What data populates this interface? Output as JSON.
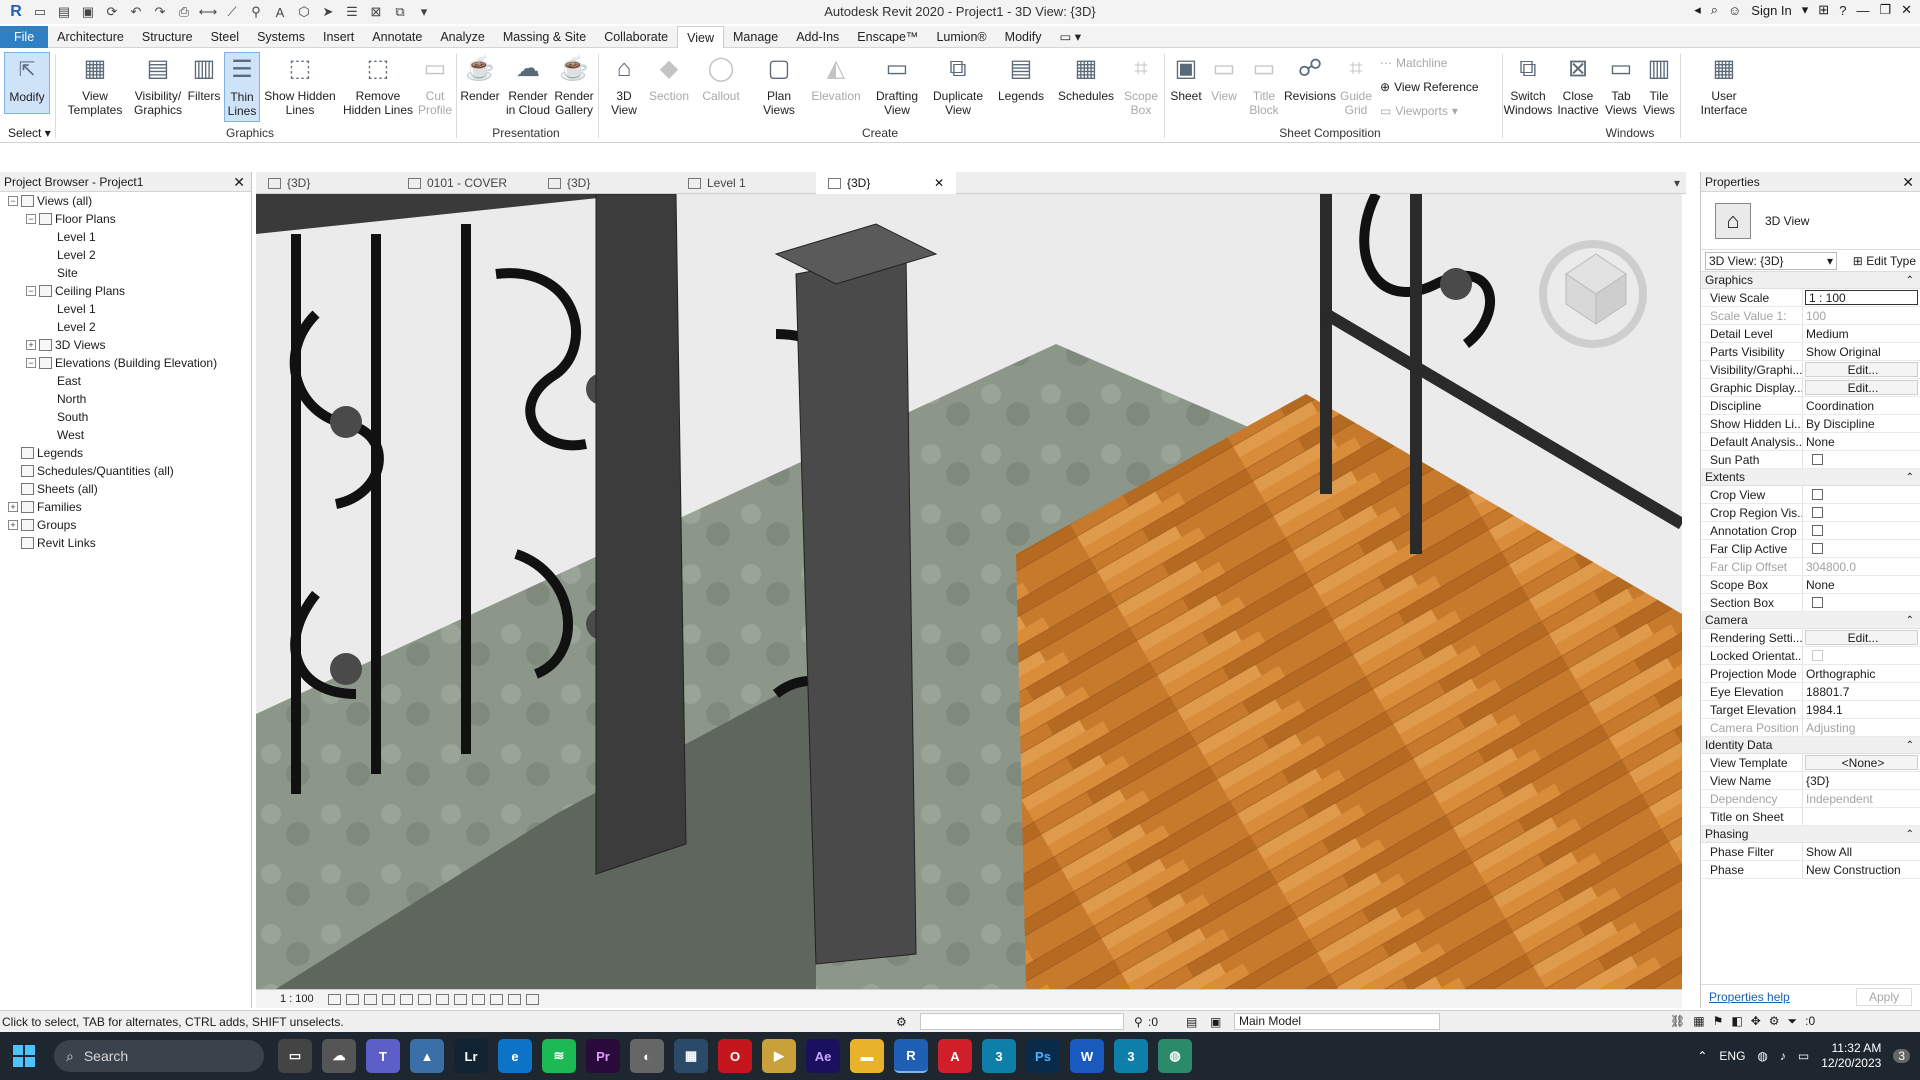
{
  "title": "Autodesk Revit 2020 - Project1 - 3D View: {3D}",
  "signin": "Sign In",
  "tabs": [
    "File",
    "Architecture",
    "Structure",
    "Steel",
    "Systems",
    "Insert",
    "Annotate",
    "Analyze",
    "Massing & Site",
    "Collaborate",
    "View",
    "Manage",
    "Add-Ins",
    "Enscape™",
    "Lumion®",
    "Modify"
  ],
  "active_tab": "View",
  "ribbon": {
    "select_label": "Select",
    "graphics_panel": "Graphics",
    "presentation_panel": "Presentation",
    "create_panel": "Create",
    "sheet_panel": "Sheet Composition",
    "windows_panel": "Windows",
    "modify": "Modify",
    "view_templates": "View Templates",
    "visibility": "Visibility/ Graphics",
    "filters": "Filters",
    "thin_lines": "Thin Lines",
    "show_hidden": "Show Hidden Lines",
    "remove_hidden": "Remove Hidden Lines",
    "cut_profile": "Cut Profile",
    "render": "Render",
    "render_cloud": "Render in Cloud",
    "render_gallery": "Render Gallery",
    "view3d": "3D View",
    "section": "Section",
    "callout": "Callout",
    "plan_views": "Plan Views",
    "elevation": "Elevation",
    "drafting": "Drafting View",
    "duplicate": "Duplicate View",
    "legends": "Legends",
    "schedules": "Schedules",
    "scope_box": "Scope Box",
    "sheet": "Sheet",
    "view": "View",
    "title_block": "Title Block",
    "revisions": "Revisions",
    "guide_grid": "Guide Grid",
    "matchline": "Matchline",
    "view_reference": "View Reference",
    "viewports": "Viewports",
    "switch_windows": "Switch Windows",
    "close_inactive": "Close Inactive",
    "tab_views": "Tab Views",
    "tile_views": "Tile Views",
    "user_interface": "User Interface"
  },
  "browser": {
    "title": "Project Browser - Project1",
    "nodes": [
      {
        "label": "Views (all)",
        "level": 0,
        "toggle": "−"
      },
      {
        "label": "Floor Plans",
        "level": 1,
        "toggle": "−"
      },
      {
        "label": "Level 1",
        "level": 2,
        "toggle": ""
      },
      {
        "label": "Level 2",
        "level": 2,
        "toggle": ""
      },
      {
        "label": "Site",
        "level": 2,
        "toggle": ""
      },
      {
        "label": "Ceiling Plans",
        "level": 1,
        "toggle": "−"
      },
      {
        "label": "Level 1",
        "level": 2,
        "toggle": ""
      },
      {
        "label": "Level 2",
        "level": 2,
        "toggle": ""
      },
      {
        "label": "3D Views",
        "level": 1,
        "toggle": "+"
      },
      {
        "label": "Elevations (Building Elevation)",
        "level": 1,
        "toggle": "−"
      },
      {
        "label": "East",
        "level": 2,
        "toggle": ""
      },
      {
        "label": "North",
        "level": 2,
        "toggle": ""
      },
      {
        "label": "South",
        "level": 2,
        "toggle": ""
      },
      {
        "label": "West",
        "level": 2,
        "toggle": ""
      },
      {
        "label": "Legends",
        "level": 0,
        "toggle": ""
      },
      {
        "label": "Schedules/Quantities (all)",
        "level": 0,
        "toggle": ""
      },
      {
        "label": "Sheets (all)",
        "level": 0,
        "toggle": ""
      },
      {
        "label": "Families",
        "level": 0,
        "toggle": "+"
      },
      {
        "label": "Groups",
        "level": 0,
        "toggle": "+"
      },
      {
        "label": "Revit Links",
        "level": 0,
        "toggle": ""
      }
    ]
  },
  "view_tabs": [
    "{3D}",
    "0101 - COVER",
    "{3D}",
    "Level 1",
    "{3D}"
  ],
  "view_scale_label": "1 : 100",
  "properties": {
    "title": "Properties",
    "type": "3D View",
    "instance": "3D View: {3D}",
    "edit_type": "Edit Type",
    "sections": [
      {
        "name": "Graphics",
        "rows": [
          {
            "k": "View Scale",
            "v": "1 : 100",
            "s": "boxed"
          },
          {
            "k": "Scale Value    1:",
            "v": "100",
            "s": "grey"
          },
          {
            "k": "Detail Level",
            "v": "Medium"
          },
          {
            "k": "Parts Visibility",
            "v": "Show Original"
          },
          {
            "k": "Visibility/Graphi...",
            "v": "Edit...",
            "s": "btn"
          },
          {
            "k": "Graphic Display...",
            "v": "Edit...",
            "s": "btn"
          },
          {
            "k": "Discipline",
            "v": "Coordination"
          },
          {
            "k": "Show Hidden Li...",
            "v": "By Discipline"
          },
          {
            "k": "Default Analysis...",
            "v": "None"
          },
          {
            "k": "Sun Path",
            "v": "",
            "s": "cb"
          }
        ]
      },
      {
        "name": "Extents",
        "rows": [
          {
            "k": "Crop View",
            "v": "",
            "s": "cb"
          },
          {
            "k": "Crop Region Vis...",
            "v": "",
            "s": "cb"
          },
          {
            "k": "Annotation Crop",
            "v": "",
            "s": "cb"
          },
          {
            "k": "Far Clip Active",
            "v": "",
            "s": "cb"
          },
          {
            "k": "Far Clip Offset",
            "v": "304800.0",
            "s": "grey"
          },
          {
            "k": "Scope Box",
            "v": "None"
          },
          {
            "k": "Section Box",
            "v": "",
            "s": "cb"
          }
        ]
      },
      {
        "name": "Camera",
        "rows": [
          {
            "k": "Rendering Setti...",
            "v": "Edit...",
            "s": "btn"
          },
          {
            "k": "Locked Orientat...",
            "v": "",
            "s": "cbgrey"
          },
          {
            "k": "Projection Mode",
            "v": "Orthographic"
          },
          {
            "k": "Eye Elevation",
            "v": "18801.7"
          },
          {
            "k": "Target Elevation",
            "v": "1984.1"
          },
          {
            "k": "Camera Position",
            "v": "Adjusting",
            "s": "grey"
          }
        ]
      },
      {
        "name": "Identity Data",
        "rows": [
          {
            "k": "View Template",
            "v": "<None>",
            "s": "btn"
          },
          {
            "k": "View Name",
            "v": "{3D}"
          },
          {
            "k": "Dependency",
            "v": "Independent",
            "s": "grey"
          },
          {
            "k": "Title on Sheet",
            "v": ""
          }
        ]
      },
      {
        "name": "Phasing",
        "rows": [
          {
            "k": "Phase Filter",
            "v": "Show All"
          },
          {
            "k": "Phase",
            "v": "New Construction"
          }
        ]
      }
    ],
    "help": "Properties help",
    "apply": "Apply"
  },
  "status": {
    "hint": "Click to select, TAB for alternates, CTRL adds, SHIFT unselects.",
    "count": ":0",
    "model": "Main Model",
    "filter_count": ":0"
  },
  "taskbar": {
    "search": "Search",
    "lang": "ENG",
    "time": "11:32 AM",
    "date": "12/20/2023",
    "notif": "3"
  }
}
